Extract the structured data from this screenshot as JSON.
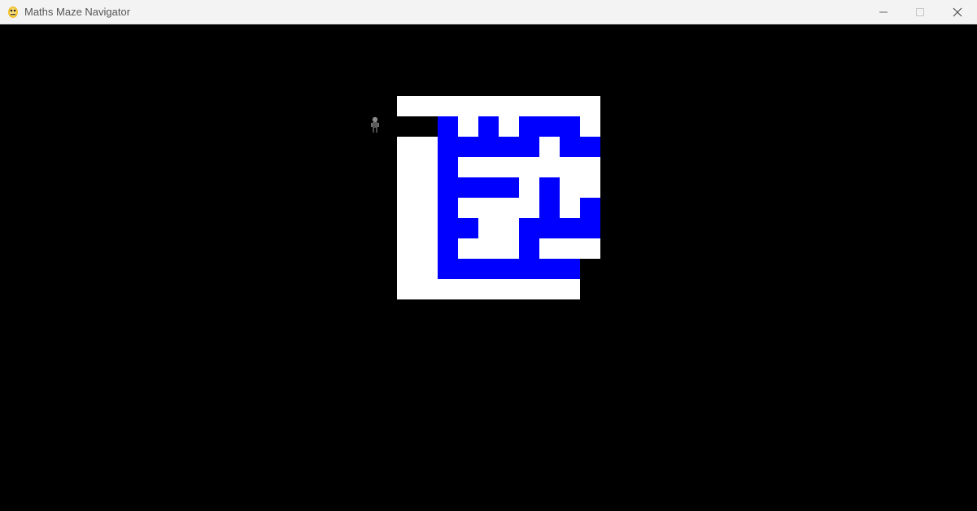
{
  "window": {
    "title": "Maths Maze Navigator"
  },
  "titlebar_buttons": {
    "minimize": "minimize-icon",
    "maximize": "maximize-icon",
    "close": "close-icon"
  },
  "maze": {
    "rows": [
      "WWWWWWWWWW",
      "..BWBWBBBW",
      "WWBBBBBWBB",
      "WWBWWWWWWW",
      "WWBBBBWBWW",
      "WWBWWWWBWB",
      "WWBBWWBBBB",
      "WWBWWWBWWW",
      "WWBBBBBBBV",
      "WWWWWWWWWV"
    ],
    "legend": {
      "W": "white",
      "B": "blue",
      ".": "black",
      "V": "void"
    },
    "colors": {
      "wall": "#ffffff",
      "path": "#0000ff",
      "empty": "#000000",
      "background": "#000000"
    }
  },
  "player": {
    "icon": "player-sprite-icon",
    "row": 1,
    "col": -1
  }
}
